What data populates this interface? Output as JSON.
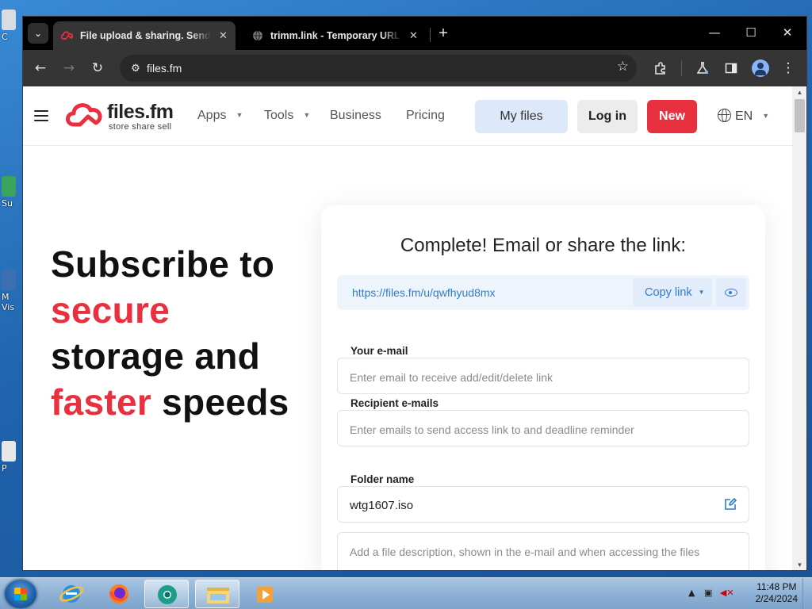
{
  "desktop": {
    "icon_labels": [
      "C",
      "Su",
      "M\nVis",
      "P"
    ]
  },
  "browser": {
    "tabs": [
      {
        "title": "File upload & sharing. Send large files",
        "icon": "files-fm-logo-icon",
        "close": "✕"
      },
      {
        "title": "trimm.link - Temporary URL shortener",
        "icon": "globe-icon",
        "close": "✕"
      }
    ],
    "new_tab": "+",
    "window_controls": {
      "minimize": "—",
      "maximize": "☐",
      "close": "✕"
    },
    "url": "files.fm"
  },
  "site": {
    "logo_word": "files.fm",
    "logo_tagline": "store  share  sell",
    "nav": {
      "apps": "Apps",
      "tools": "Tools",
      "business": "Business",
      "pricing": "Pricing"
    },
    "my_files": "My files",
    "login": "Log in",
    "new": "New",
    "lang": "EN",
    "brand_color": "#e8303f",
    "accent_color": "#2f7cd3"
  },
  "hero": {
    "line1": "Subscribe to",
    "line2": "secure",
    "line3": "storage and",
    "line4a": "faster",
    "line4b": " speeds"
  },
  "card": {
    "title": "Complete! Email or share the link:",
    "share_url": "https://files.fm/u/qwfhyud8mx",
    "copy_link": "Copy link",
    "your_email_label": "Your e-mail",
    "your_email_placeholder": "Enter email to receive add/edit/delete link",
    "recipient_label": "Recipient e-mails",
    "recipient_placeholder": "Enter emails to send access link to and deadline reminder",
    "folder_label": "Folder name",
    "folder_value": "wtg1607.iso",
    "description_placeholder": "Add a file description, shown in the e-mail and when accessing the files"
  },
  "taskbar": {
    "time": "11:48 PM",
    "date": "2/24/2024"
  }
}
